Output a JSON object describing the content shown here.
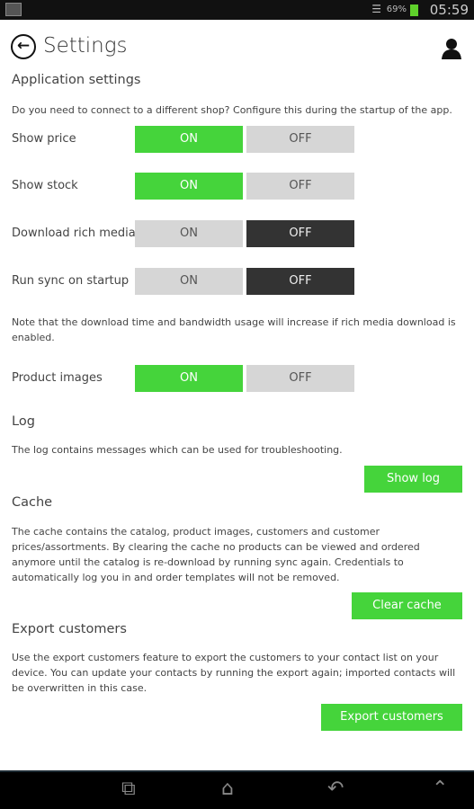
{
  "status": {
    "battery": "69%",
    "time": "05:59"
  },
  "header": {
    "title": "Settings"
  },
  "app": {
    "heading": "Application settings",
    "desc": "Do you need to connect to a different shop? Configure this during the startup of the app.",
    "toggles": [
      {
        "label": "Show price",
        "on": "ON",
        "off": "OFF",
        "value": "on"
      },
      {
        "label": "Show stock",
        "on": "ON",
        "off": "OFF",
        "value": "on"
      },
      {
        "label": "Download rich media",
        "on": "ON",
        "off": "OFF",
        "value": "off"
      },
      {
        "label": "Run sync on startup",
        "on": "ON",
        "off": "OFF",
        "value": "off"
      }
    ],
    "note": "Note that the download time and bandwidth usage will increase if rich media download is enabled.",
    "images": {
      "label": "Product images",
      "on": "ON",
      "off": "OFF",
      "value": "on"
    }
  },
  "log": {
    "heading": "Log",
    "desc": "The log contains messages which can be used for troubleshooting.",
    "button": "Show log"
  },
  "cache": {
    "heading": "Cache",
    "desc": "The cache contains the catalog, product images, customers and customer prices/assortments. By clearing the cache no products can be viewed and ordered anymore until the catalog is re-download by running sync again. Credentials to automatically log you in and order templates will not be removed.",
    "button": "Clear cache"
  },
  "export": {
    "heading": "Export customers",
    "desc": "Use the export customers feature to export the customers to your contact list on your device. You can update your contacts by running the export again; imported contacts will be overwritten in this case.",
    "button": "Export customers"
  },
  "colors": {
    "accent": "#45d43b",
    "off_selected": "#333333",
    "unselected": "#d6d6d6"
  }
}
